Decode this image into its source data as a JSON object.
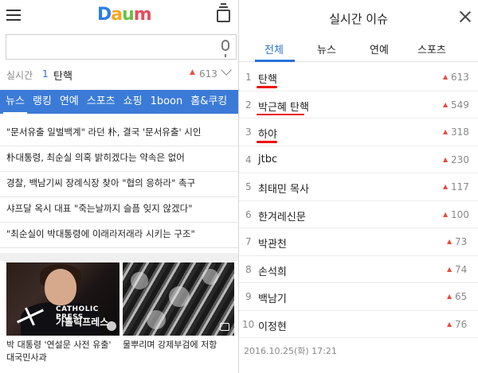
{
  "left": {
    "logo": {
      "d": "D",
      "a": "a",
      "u": "u",
      "m": "m"
    },
    "search": {
      "value": "",
      "placeholder": ""
    },
    "realtime": {
      "label": "실시간",
      "rank": "1",
      "keyword": "탄핵",
      "arrow": "▲",
      "count": "613"
    },
    "categories": [
      {
        "label": "뉴스",
        "active": true
      },
      {
        "label": "랭킹"
      },
      {
        "label": "연예"
      },
      {
        "label": "스포츠"
      },
      {
        "label": "쇼핑"
      },
      {
        "label": "1boon"
      },
      {
        "label": "홈&쿠킹"
      }
    ],
    "news": [
      "\"문서유출 일벌백계\" 라던 朴, 결국 '문서유출' 시인",
      "朴대통령, 최순실 의혹 밝히겠다는 약속은 없어",
      "경찰, 백남기씨 장례식장 찾아 \"협의 응하라\" 촉구",
      "샤프달 옥시 대표 \"죽는날까지 슬픔 잊지 않겠다\"",
      "\"최순실이 박대통령에 이래라저래라 시키는 구조\""
    ],
    "thumbs": [
      {
        "caption": "박 대통령 '연설문 사전 유출' 대국민사과",
        "overlay_top": "CATHOLIC PRESS",
        "overlay_bottom": "가톨릭프레스"
      },
      {
        "caption": "물뿌리며 강제부검에 저항"
      }
    ]
  },
  "right": {
    "title": "실시간 이슈",
    "tabs": [
      {
        "label": "전체",
        "active": true
      },
      {
        "label": "뉴스"
      },
      {
        "label": "연예"
      },
      {
        "label": "스포츠"
      }
    ],
    "issues": [
      {
        "rank": "1",
        "keyword": "탄핵",
        "count": "613",
        "underlined": true
      },
      {
        "rank": "2",
        "keyword": "박근혜 탄핵",
        "count": "549",
        "underlined": true
      },
      {
        "rank": "3",
        "keyword": "하야",
        "count": "318",
        "underlined": true
      },
      {
        "rank": "4",
        "keyword": "jtbc",
        "count": "230"
      },
      {
        "rank": "5",
        "keyword": "최태민 목사",
        "count": "117"
      },
      {
        "rank": "6",
        "keyword": "한겨레신문",
        "count": "100"
      },
      {
        "rank": "7",
        "keyword": "박관천",
        "count": "73"
      },
      {
        "rank": "8",
        "keyword": "손석희",
        "count": "74"
      },
      {
        "rank": "9",
        "keyword": "백남기",
        "count": "65"
      },
      {
        "rank": "10",
        "keyword": "이정현",
        "count": "76"
      }
    ],
    "arrow": "▲",
    "timestamp": "2016.10.25(화) 17:21"
  },
  "colors": {
    "accent": "#3b7bd7",
    "tab_active": "#2a70d8",
    "up_arrow": "#e94b3c",
    "annotation_red": "#e11111"
  }
}
